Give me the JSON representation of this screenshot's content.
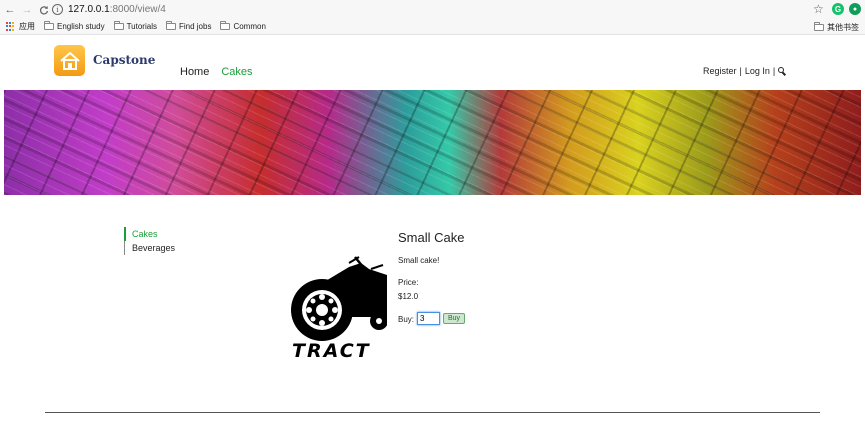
{
  "browser": {
    "back_icon": "←",
    "forward_icon": "→",
    "reload_icon": "C",
    "url_host": "127.0.0.1",
    "url_path": ":8000/view/4",
    "bookmarks": [
      {
        "label": "应用"
      },
      {
        "label": "English study"
      },
      {
        "label": "Tutorials"
      },
      {
        "label": "Find jobs"
      },
      {
        "label": "Common"
      }
    ],
    "other_bookmarks": "其他书签",
    "ext1": "G"
  },
  "site": {
    "brand": "Capstone",
    "nav": {
      "home": "Home",
      "cakes": "Cakes"
    },
    "user_nav": {
      "register": "Register",
      "sep1": "|",
      "login": "Log In",
      "sep2": "|"
    },
    "accent_color": "#1a9e3a"
  },
  "sidebar": {
    "items": [
      {
        "label": "Cakes",
        "active": true
      },
      {
        "label": "Beverages",
        "active": false
      }
    ]
  },
  "product": {
    "title": "Small Cake",
    "description": "Small cake!",
    "price_label": "Price:",
    "price": "$12.0",
    "buy_label": "Buy:",
    "quantity": "3",
    "buy_button": "Buy",
    "image_text": "TRACT"
  }
}
